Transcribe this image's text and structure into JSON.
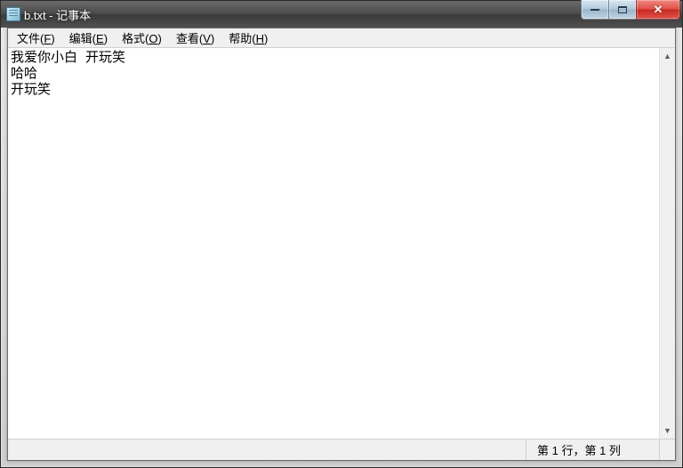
{
  "titlebar": {
    "app_icon": "notepad-icon",
    "title": "b.txt - 记事本"
  },
  "window_controls": {
    "minimize": "minimize",
    "maximize": "maximize",
    "close": "close"
  },
  "menubar": {
    "items": [
      {
        "label": "文件",
        "hotkey": "F"
      },
      {
        "label": "编辑",
        "hotkey": "E"
      },
      {
        "label": "格式",
        "hotkey": "O"
      },
      {
        "label": "查看",
        "hotkey": "V"
      },
      {
        "label": "帮助",
        "hotkey": "H"
      }
    ]
  },
  "editor": {
    "content": "我爱你小白 开玩笑\n哈哈\n开玩笑"
  },
  "statusbar": {
    "position": "第 1 行，第 1 列"
  }
}
